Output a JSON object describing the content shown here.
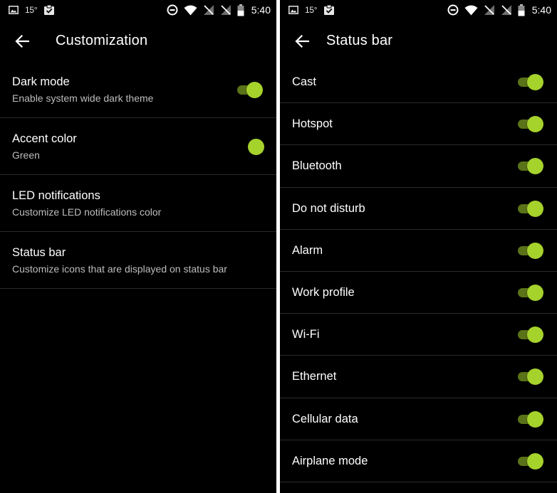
{
  "colors": {
    "accent": "#a6d22c",
    "background": "#000000",
    "divider": "#2a2a2a",
    "secondary_text": "#bdbdbd"
  },
  "status_bar": {
    "temperature": "15°",
    "time": "5:40",
    "icons": [
      "image-icon",
      "clipboard-check-icon",
      "data-saver-icon",
      "wifi-icon",
      "no-signal-icon",
      "no-signal-icon",
      "battery-icon"
    ]
  },
  "customization": {
    "title": "Customization",
    "items": [
      {
        "title": "Dark mode",
        "summary": "Enable system wide dark theme",
        "control": "toggle",
        "on": true
      },
      {
        "title": "Accent color",
        "summary": "Green",
        "control": "color-dot"
      },
      {
        "title": "LED notifications",
        "summary": "Customize LED notifications color"
      },
      {
        "title": "Status bar",
        "summary": "Customize icons that are displayed on status bar"
      }
    ]
  },
  "status_bar_screen": {
    "title": "Status bar",
    "items": [
      {
        "label": "Cast",
        "on": true
      },
      {
        "label": "Hotspot",
        "on": true
      },
      {
        "label": "Bluetooth",
        "on": true
      },
      {
        "label": "Do not disturb",
        "on": true
      },
      {
        "label": "Alarm",
        "on": true
      },
      {
        "label": "Work profile",
        "on": true
      },
      {
        "label": "Wi-Fi",
        "on": true
      },
      {
        "label": "Ethernet",
        "on": true
      },
      {
        "label": "Cellular data",
        "on": true
      },
      {
        "label": "Airplane mode",
        "on": true
      }
    ]
  }
}
